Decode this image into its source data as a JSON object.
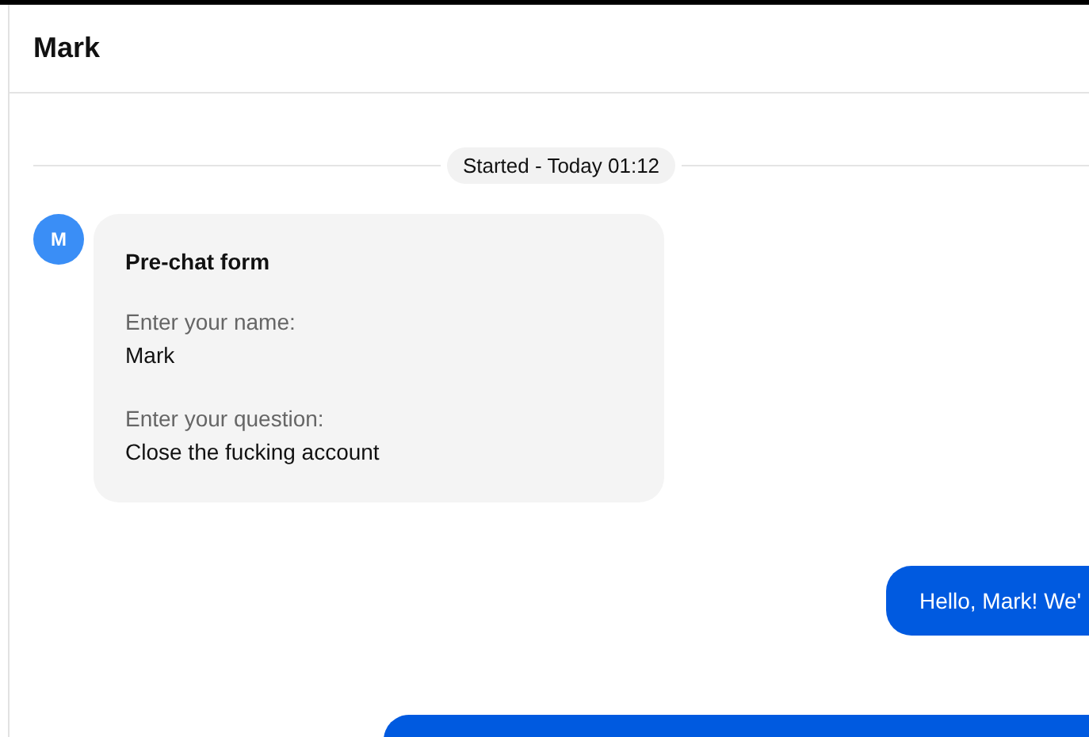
{
  "header": {
    "title": "Mark"
  },
  "timeline": {
    "label": "Started - Today 01:12"
  },
  "messages": [
    {
      "kind": "form",
      "avatar": "M",
      "title": "Pre-chat form",
      "fields": [
        {
          "label": "Enter your name:",
          "value": "Mark"
        },
        {
          "label": "Enter your question:",
          "value": "Close the fucking account"
        }
      ]
    },
    {
      "kind": "outgoing",
      "text": "Hello, Mark! We'"
    },
    {
      "kind": "clipped"
    }
  ]
}
